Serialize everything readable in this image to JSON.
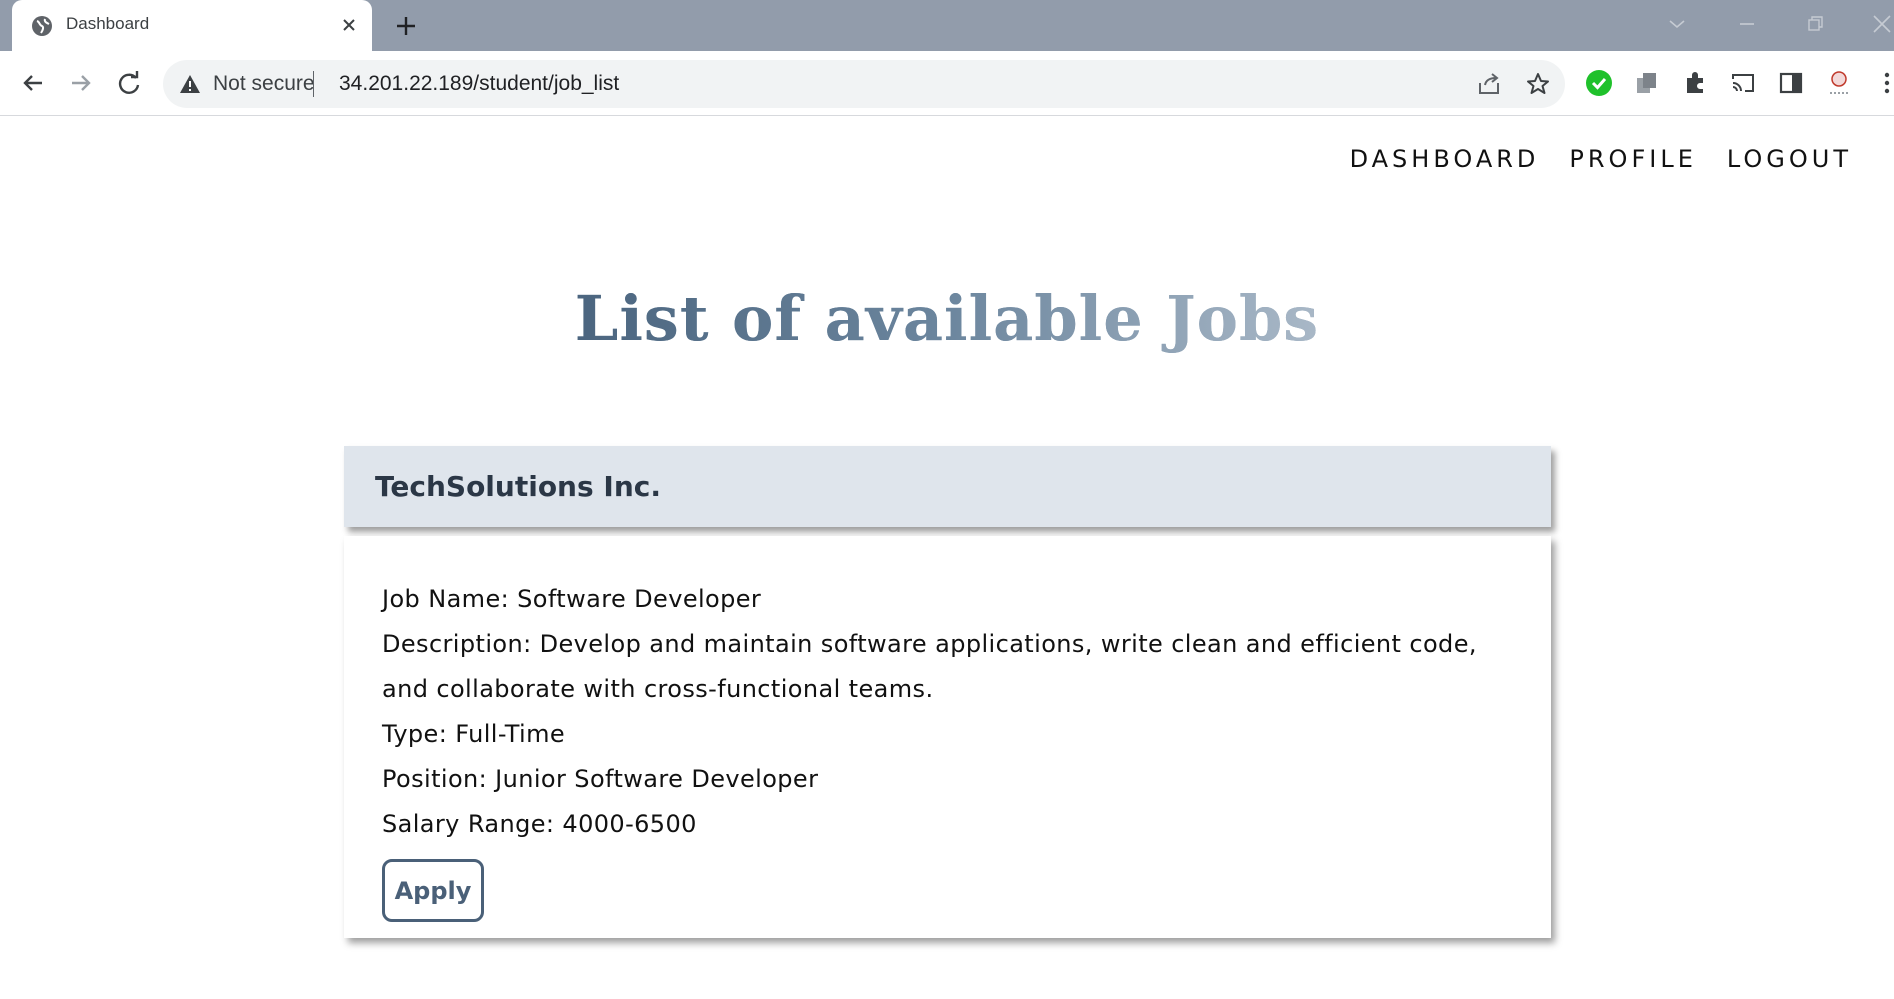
{
  "browser": {
    "tab_title": "Dashboard",
    "security_label": "Not secure",
    "url": "34.201.22.189/student/job_list"
  },
  "nav": {
    "items": [
      {
        "label": "DASHBOARD"
      },
      {
        "label": "PROFILE"
      },
      {
        "label": "LOGOUT"
      }
    ]
  },
  "page": {
    "title": "List of available Jobs"
  },
  "jobs": [
    {
      "company": "TechSolutions Inc.",
      "name_line": "Job Name: Software Developer",
      "description_line": "Description: Develop and maintain software applications, write clean and efficient code,",
      "description_line_2": "and collaborate with cross-functional teams.",
      "type_line": "Type: Full-Time",
      "position_line": "Position: Junior Software Developer",
      "salary_line": "Salary Range: 4000-6500",
      "apply_label": "Apply"
    }
  ],
  "colors": {
    "accent": "#4a6078",
    "card_header_bg": "#dfe5ec",
    "tabbar_bg": "#929cab"
  }
}
